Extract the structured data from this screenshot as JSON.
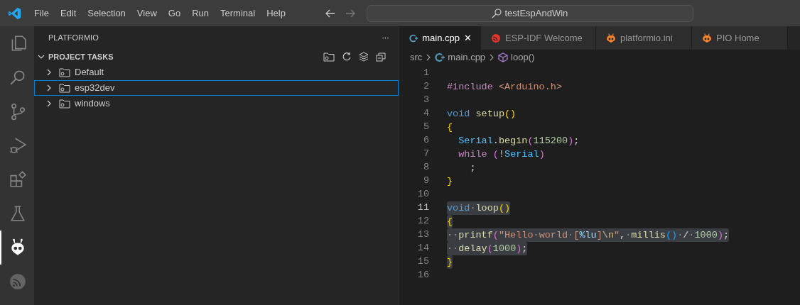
{
  "menu_bar": {
    "items": [
      "File",
      "Edit",
      "Selection",
      "View",
      "Go",
      "Run",
      "Terminal",
      "Help"
    ],
    "search": {
      "value": "testEspAndWin"
    }
  },
  "activity_bar": [
    {
      "selected": false
    },
    {
      "selected": false
    },
    {
      "selected": false
    },
    {
      "selected": false
    },
    {
      "selected": false
    },
    {
      "selected": false
    },
    {
      "selected": true
    },
    {
      "selected": false
    }
  ],
  "sidebar": {
    "title": "PLATFORMIO",
    "more": "···",
    "section": {
      "title": "PROJECT TASKS",
      "expanded": true,
      "items": [
        {
          "label": "Default",
          "focused": false
        },
        {
          "label": "esp32dev",
          "focused": true
        },
        {
          "label": "windows",
          "focused": false
        }
      ]
    }
  },
  "tabs": [
    {
      "label": "main.cpp",
      "kind": "cpp",
      "selected": true,
      "close": "✕"
    },
    {
      "label": "ESP-IDF Welcome",
      "kind": "esp",
      "selected": false
    },
    {
      "label": "platformio.ini",
      "kind": "pio",
      "selected": false
    },
    {
      "label": "PIO Home",
      "kind": "pio",
      "selected": false
    }
  ],
  "breadcrumb": [
    {
      "label": "src",
      "kind": "folder"
    },
    {
      "label": "main.cpp",
      "kind": "cpp"
    },
    {
      "label": "loop()",
      "kind": "method"
    }
  ],
  "code": [
    {
      "number": "1",
      "current": false,
      "selected": false
    },
    {
      "number": "2",
      "current": false,
      "selected": false,
      "tokens": [
        {
          "text": "#include",
          "kind": "control"
        },
        {
          "text": " <Arduino.h>",
          "kind": "string"
        }
      ]
    },
    {
      "number": "3",
      "current": false,
      "selected": false
    },
    {
      "number": "4",
      "current": false,
      "selected": false,
      "tokens": [
        {
          "text": "void",
          "kind": "keyword"
        },
        {
          "text": " setup",
          "kind": "function"
        },
        {
          "text": "()",
          "kind": "bracket1"
        }
      ]
    },
    {
      "number": "5",
      "current": false,
      "selected": false,
      "tokens": [
        {
          "text": "{",
          "kind": "bracket1"
        }
      ]
    },
    {
      "number": "6",
      "current": false,
      "selected": false,
      "tokens": [
        {
          "text": "  Serial",
          "kind": "variable"
        },
        {
          "text": ".",
          "kind": "plain"
        },
        {
          "text": "begin",
          "kind": "function"
        },
        {
          "text": "(",
          "kind": "bracket2"
        },
        {
          "text": "115200",
          "kind": "number"
        },
        {
          "text": ")",
          "kind": "bracket2"
        },
        {
          "text": ";",
          "kind": "plain"
        }
      ]
    },
    {
      "number": "7",
      "current": false,
      "selected": false,
      "tokens": [
        {
          "text": "  while",
          "kind": "control"
        },
        {
          "text": " (",
          "kind": "bracket2"
        },
        {
          "text": "!",
          "kind": "plain"
        },
        {
          "text": "Serial",
          "kind": "variable"
        },
        {
          "text": ")",
          "kind": "bracket2"
        }
      ]
    },
    {
      "number": "8",
      "current": false,
      "selected": false,
      "tokens": [
        {
          "text": "    ;",
          "kind": "plain"
        }
      ]
    },
    {
      "number": "9",
      "current": false,
      "selected": false,
      "tokens": [
        {
          "text": "}",
          "kind": "bracket1"
        }
      ]
    },
    {
      "number": "10",
      "current": false,
      "selected": false
    },
    {
      "number": "11",
      "current": true,
      "selected": true,
      "tokens": [
        {
          "text": "void",
          "kind": "keyword"
        },
        {
          "text": "·",
          "kind": "whitespace"
        },
        {
          "text": "loop",
          "kind": "function"
        },
        {
          "text": "()",
          "kind": "bracket1"
        }
      ]
    },
    {
      "number": "12",
      "current": false,
      "selected": true,
      "tokens": [
        {
          "text": "{",
          "kind": "bracket1"
        }
      ]
    },
    {
      "number": "13",
      "current": false,
      "selected": true,
      "tokens": [
        {
          "text": "··",
          "kind": "whitespace"
        },
        {
          "text": "printf",
          "kind": "function"
        },
        {
          "text": "(",
          "kind": "bracket2"
        },
        {
          "text": "\"Hello",
          "kind": "string"
        },
        {
          "text": "·",
          "kind": "whitespace"
        },
        {
          "text": "world",
          "kind": "string"
        },
        {
          "text": "·",
          "kind": "whitespace"
        },
        {
          "text": "[",
          "kind": "string"
        },
        {
          "text": "%lu",
          "kind": "format"
        },
        {
          "text": "]",
          "kind": "string"
        },
        {
          "text": "\\n",
          "kind": "escape"
        },
        {
          "text": "\"",
          "kind": "string"
        },
        {
          "text": ",",
          "kind": "plain"
        },
        {
          "text": "·",
          "kind": "whitespace"
        },
        {
          "text": "millis",
          "kind": "function"
        },
        {
          "text": "()",
          "kind": "bracket3"
        },
        {
          "text": "·",
          "kind": "whitespace"
        },
        {
          "text": "/",
          "kind": "plain"
        },
        {
          "text": "·",
          "kind": "whitespace"
        },
        {
          "text": "1000",
          "kind": "number"
        },
        {
          "text": ")",
          "kind": "bracket2"
        },
        {
          "text": ";",
          "kind": "plain"
        }
      ]
    },
    {
      "number": "14",
      "current": false,
      "selected": true,
      "tokens": [
        {
          "text": "··",
          "kind": "whitespace"
        },
        {
          "text": "delay",
          "kind": "function"
        },
        {
          "text": "(",
          "kind": "bracket2"
        },
        {
          "text": "1000",
          "kind": "number"
        },
        {
          "text": ")",
          "kind": "bracket2"
        },
        {
          "text": ";",
          "kind": "plain"
        }
      ]
    },
    {
      "number": "15",
      "current": false,
      "selected": true,
      "tokens": [
        {
          "text": "}",
          "kind": "bracket1"
        }
      ]
    },
    {
      "number": "16",
      "current": false,
      "selected": false
    }
  ]
}
